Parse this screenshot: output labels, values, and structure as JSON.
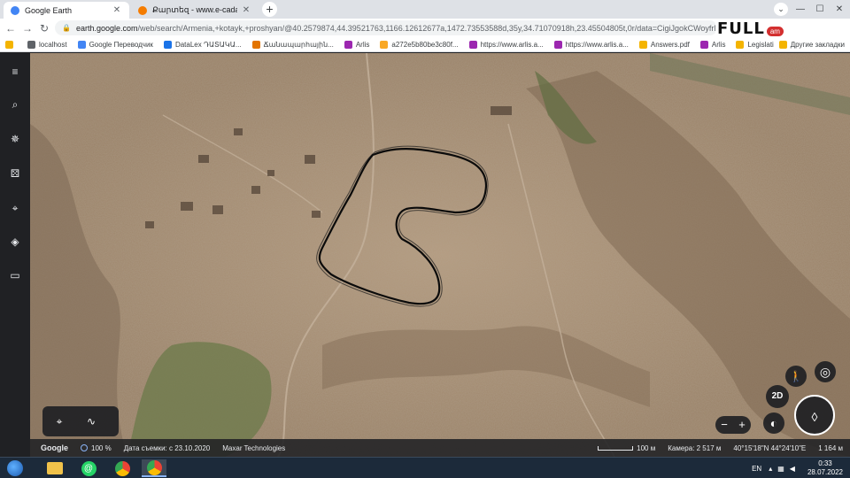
{
  "browser": {
    "tabs": [
      {
        "label": "Google Earth",
        "active": true,
        "favicon_color": "#4285f4"
      },
      {
        "label": "Քարտեզ - www.e-cadastre.am",
        "active": false,
        "favicon_color": "#f57c00"
      }
    ],
    "new_tab_label": "+",
    "tab_search_label": "⌄",
    "window_controls": {
      "minimize": "—",
      "maximize": "☐",
      "close": "✕"
    },
    "nav": {
      "back": "←",
      "forward": "→",
      "reload": "↻"
    },
    "url_host": "earth.google.com",
    "url_path": "/web/search/Armenia,+kotayk,+proshyan/@40.2579874,44.39521763,1166.12612677a,1472.73553588d,35y,34.71070918h,23.45504805t,0r/data=CigiJgokCWoyfrNGu0hAEVo6O..."
  },
  "bookmarks": [
    {
      "label": "",
      "icon_color": "#f4b400"
    },
    {
      "label": "localhost",
      "icon_color": "#5f6368"
    },
    {
      "label": "Google Переводчик",
      "icon_color": "#4285f4"
    },
    {
      "label": "DataLex ԴԱՏԱԿԱ...",
      "icon_color": "#1a73e8"
    },
    {
      "label": "Ճանապարհային...",
      "icon_color": "#e37400"
    },
    {
      "label": "Arlis",
      "icon_color": "#9c27b0"
    },
    {
      "label": "a272e5b80be3c80f...",
      "icon_color": "#f9a825"
    },
    {
      "label": "https://www.arlis.a...",
      "icon_color": "#9c27b0"
    },
    {
      "label": "https://www.arlis.a...",
      "icon_color": "#9c27b0"
    },
    {
      "label": "Answers.pdf",
      "icon_color": "#f4b400"
    },
    {
      "label": "Arlis",
      "icon_color": "#9c27b0"
    },
    {
      "label": "Legislation: Nationa...",
      "icon_color": "#f4b400"
    }
  ],
  "bookmarks_other": "Другие закладки",
  "watermark": {
    "text": "FULL",
    "sub": "am"
  },
  "sidebar": [
    {
      "name": "menu-icon",
      "glyph": "≡"
    },
    {
      "name": "search-icon",
      "glyph": "⌕"
    },
    {
      "name": "voyager-icon",
      "glyph": "✵"
    },
    {
      "name": "feeling-lucky-icon",
      "glyph": "⚄"
    },
    {
      "name": "projects-icon",
      "glyph": "⌖"
    },
    {
      "name": "map-style-icon",
      "glyph": "◈"
    },
    {
      "name": "measure-icon",
      "glyph": "▭"
    }
  ],
  "map_controls": {
    "pegman": "🚶",
    "location": "◎",
    "mode_2d": "2D",
    "zoom_out": "−",
    "zoom_in": "+",
    "globe": "◐",
    "compass": "◊",
    "draw_point": "⌖",
    "draw_path": "∿"
  },
  "status": {
    "brand": "Google",
    "zoom": "100 %",
    "imagery_date": "Дата съемки: с 23.10.2020",
    "provider": "Maxar Technologies",
    "scale": "100 м",
    "camera": "Камера: 2 517 м",
    "coords": "40°15'18\"N 44°24'10\"E",
    "elevation": "1 164 м"
  },
  "taskbar": {
    "language": "EN",
    "time": "0:33",
    "date": "28.07.2022"
  },
  "colors": {
    "terrain": "#a68e74",
    "terrain_dark": "#7a6450",
    "vegetation": "#6b7a4a",
    "boundary": "#0b0b0b"
  }
}
